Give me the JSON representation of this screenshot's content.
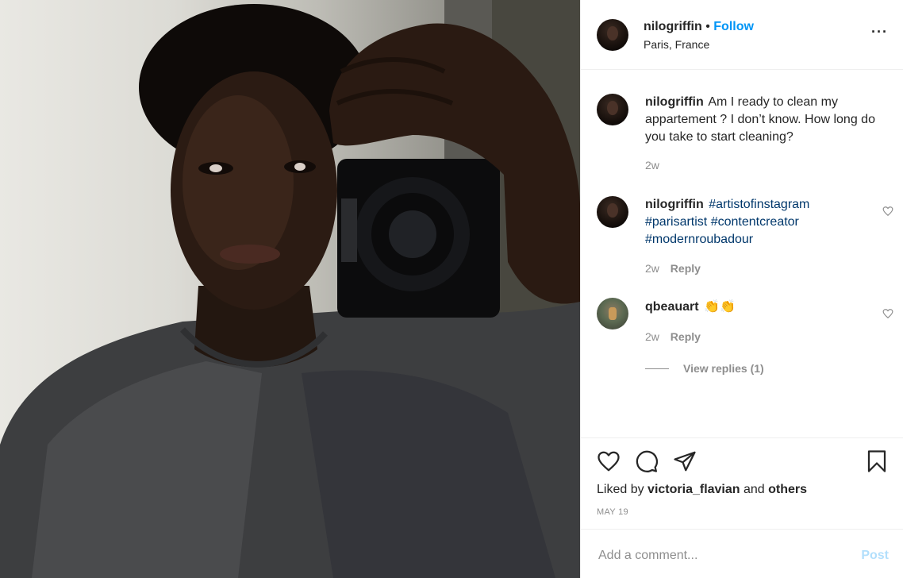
{
  "post": {
    "author": "nilogriffin",
    "separator": "•",
    "follow_label": "Follow",
    "location": "Paris, France",
    "more_label": "···"
  },
  "comments": [
    {
      "user": "nilogriffin",
      "text": "Am I ready to clean my appartement ? I don’t know. How long do you take to start cleaning?",
      "time": "2w"
    },
    {
      "user": "nilogriffin",
      "tags": [
        "#artistofinstagram",
        "#parisartist",
        "#contentcreator",
        "#modernroubadour"
      ],
      "time": "2w",
      "reply_label": "Reply"
    },
    {
      "user": "qbeauart",
      "text": "👏👏",
      "time": "2w",
      "reply_label": "Reply"
    }
  ],
  "view_replies_label": "View replies (1)",
  "likes": {
    "prefix": "Liked by",
    "user": "victoria_flavian",
    "and": "and",
    "others": "others"
  },
  "date": "MAY 19",
  "add_comment": {
    "placeholder": "Add a comment...",
    "post_label": "Post"
  },
  "icons": [
    "heart-icon",
    "comment-icon",
    "share-icon",
    "bookmark-icon",
    "more-icon"
  ],
  "colors": {
    "link": "#0095f6",
    "hashtag": "#00376b",
    "muted": "#8e8e8e",
    "post_disabled": "#b2dffc"
  }
}
